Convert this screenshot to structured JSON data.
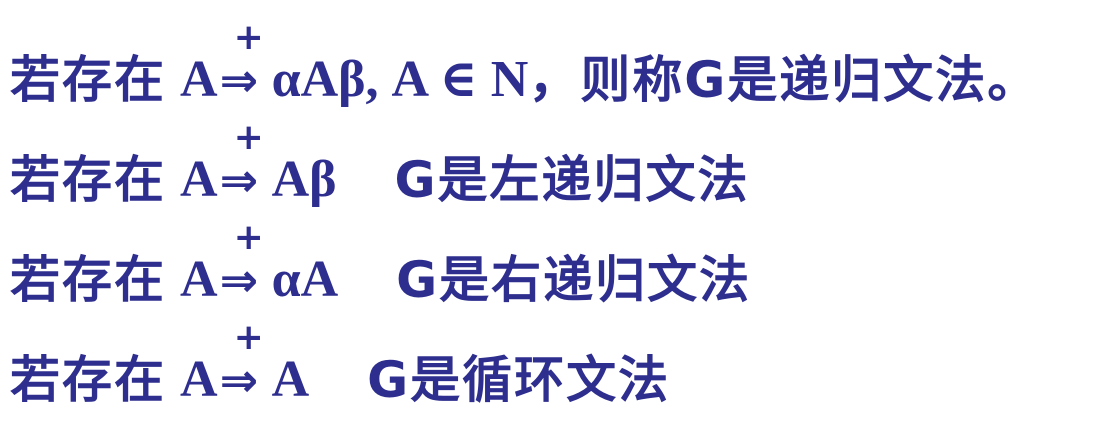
{
  "lines": [
    {
      "prefix": "若存在",
      "lhs": "A",
      "plus": "+",
      "arrow": "⇒",
      "rhs": "αAβ, A ∈ N，",
      "desc": "则称G是递归文法。"
    },
    {
      "prefix": "若存在",
      "lhs": "A",
      "plus": "+",
      "arrow": "⇒",
      "rhs": "Aβ",
      "desc": "G是左递归文法"
    },
    {
      "prefix": "若存在",
      "lhs": "A",
      "plus": "+",
      "arrow": "⇒",
      "rhs": "αA",
      "desc": "G是右递归文法"
    },
    {
      "prefix": "若存在",
      "lhs": "A",
      "plus": "+",
      "arrow": "⇒",
      "rhs": "A",
      "desc": "G是循环文法"
    }
  ],
  "colors": {
    "text": "#2e2e8f",
    "background": "#ffffff"
  }
}
